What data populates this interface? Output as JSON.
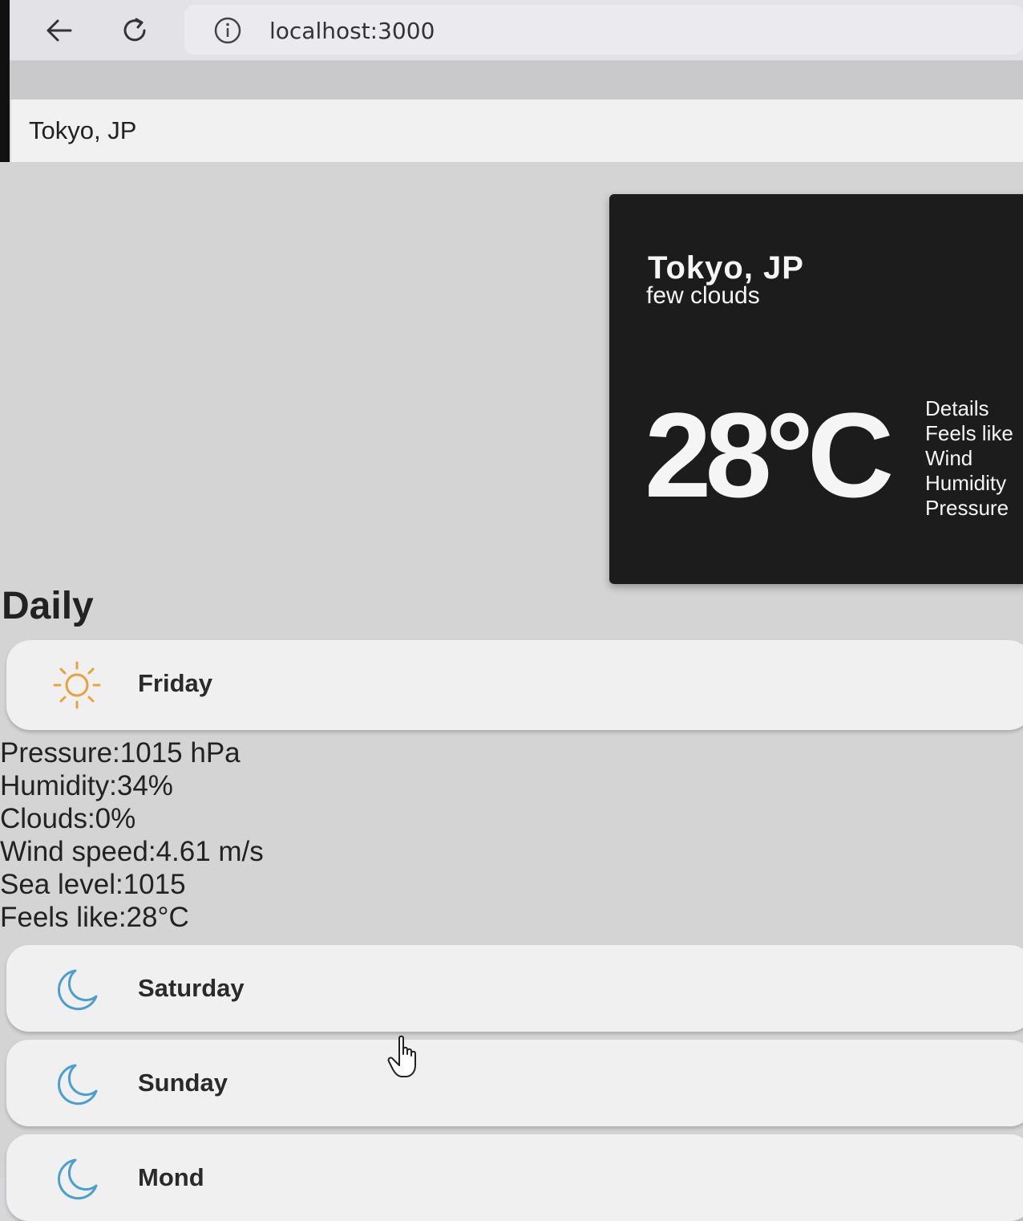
{
  "browser": {
    "url": "localhost:3000",
    "icons": {
      "back": "arrow-left-icon",
      "reload": "reload-icon",
      "info": "info-icon"
    }
  },
  "search": {
    "value": "Tokyo, JP"
  },
  "current": {
    "city": "Tokyo, JP",
    "description": "few clouds",
    "temperature": "28°C",
    "details_header": "Details",
    "detail_labels": [
      "Feels like",
      "Wind",
      "Humidity",
      "Pressure"
    ]
  },
  "daily": {
    "title": "Daily",
    "days": [
      {
        "name": "Friday",
        "icon": "sun-icon"
      },
      {
        "name": "Saturday",
        "icon": "moon-icon"
      },
      {
        "name": "Sunday",
        "icon": "moon-icon"
      },
      {
        "name": "Mond",
        "icon": "moon-icon"
      }
    ],
    "friday_details": [
      "Pressure:1015 hPa",
      "Humidity:34%",
      "Clouds:0%",
      "Wind speed:4.61 m/s",
      "Sea level:1015",
      "Feels like:28°C"
    ]
  },
  "colors": {
    "sun": "#e8a23c",
    "moon": "#4a9fd0",
    "card_bg": "#1d1c1c"
  }
}
